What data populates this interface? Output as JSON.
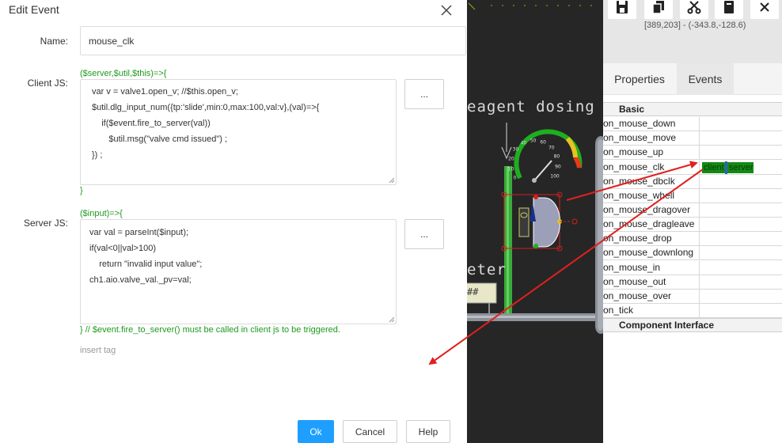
{
  "dialog": {
    "title": "Edit Event",
    "name_label": "Name:",
    "name_value": "mouse_clk",
    "client_label": "Client JS:",
    "client_sig_open": "($server,$util,$this)=>{",
    "client_lines": [
      "var v = valve1.open_v; //$this.open_v;",
      "$util.dlg_input_num({tp:'slide',min:0,max:100,val:v},(val)=>{",
      "    if($event.fire_to_server(val))",
      "       $util.msg(\"valve cmd issued\") ;",
      "}) ;"
    ],
    "client_sig_close": "}",
    "server_label": "Server JS:",
    "server_sig_open": "($input)=>{",
    "server_lines": [
      "var val = parseInt($input);",
      "if(val<0||val>100)",
      "    return \"invalid input value\";",
      "ch1.aio.valve_val._pv=val;"
    ],
    "server_sig_close": "} // $event.fire_to_server() must be called in client js to be triggered.",
    "dots_label": "...",
    "insert_tag": "insert tag",
    "ok_label": "Ok",
    "cancel_label": "Cancel",
    "help_label": "Help"
  },
  "canvas": {
    "title_text": "eagent dosing",
    "label_text": "eter",
    "hash_text": "##",
    "gauge_ticks": [
      "0",
      "10",
      "20",
      "30",
      "40",
      "50",
      "60",
      "70",
      "80",
      "90",
      "100"
    ]
  },
  "toolbar": {
    "coords": "[389,203] - (-343.8,-128.6)",
    "icons": [
      "save-icon",
      "copy-icon",
      "cut-icon",
      "paste-icon",
      "close-icon"
    ]
  },
  "tabs": {
    "properties": "Properties",
    "events": "Events"
  },
  "events_grid": {
    "group_basic": "Basic",
    "rows": [
      "on_mouse_down",
      "on_mouse_move",
      "on_mouse_up",
      "on_mouse_clk",
      "on_mouse_dbclk",
      "on_mouse_whell",
      "on_mouse_dragover",
      "on_mouse_dragleave",
      "on_mouse_drop",
      "on_mouse_downlong",
      "on_mouse_in",
      "on_mouse_out",
      "on_mouse_over",
      "on_tick"
    ],
    "clk_client": "client",
    "clk_server": "server",
    "group_interface": "Component Interface"
  },
  "colors": {
    "accent_blue": "#1e9fff",
    "code_green": "#1d9a1d",
    "annotation_red": "#e02020",
    "chip_green": "#138a13"
  }
}
